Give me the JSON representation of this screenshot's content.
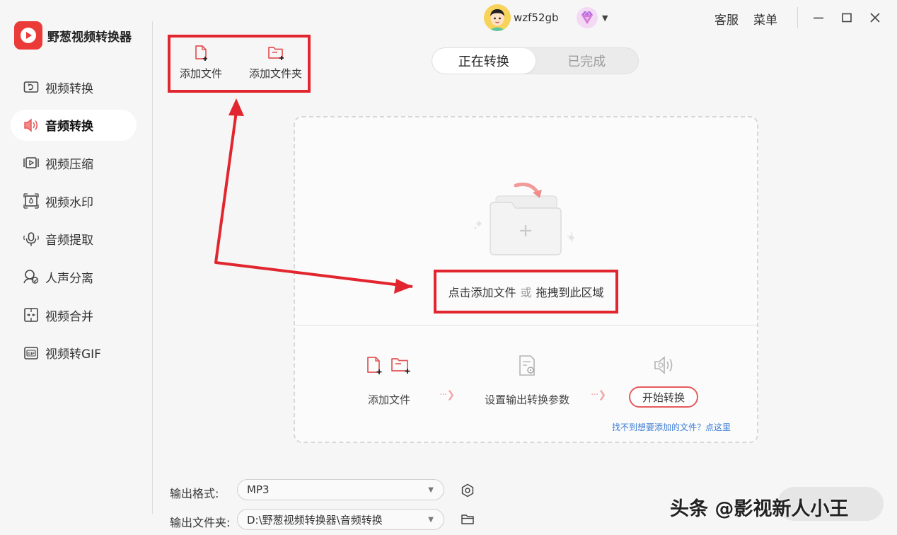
{
  "app": {
    "name": "野葱视频转换器",
    "accent": "#ea3b39"
  },
  "sidebar": {
    "items": [
      {
        "label": "视频转换",
        "icon": "video-convert-icon",
        "active": false
      },
      {
        "label": "音频转换",
        "icon": "audio-convert-icon",
        "active": true
      },
      {
        "label": "视频压缩",
        "icon": "video-compress-icon",
        "active": false
      },
      {
        "label": "视频水印",
        "icon": "video-watermark-icon",
        "active": false
      },
      {
        "label": "音频提取",
        "icon": "audio-extract-icon",
        "active": false
      },
      {
        "label": "人声分离",
        "icon": "vocal-separate-icon",
        "active": false
      },
      {
        "label": "视频合并",
        "icon": "video-merge-icon",
        "active": false
      },
      {
        "label": "视频转GIF",
        "icon": "video-gif-icon",
        "active": false
      }
    ]
  },
  "header": {
    "username": "wzf52gb",
    "service": "客服",
    "menu": "菜单"
  },
  "toolbar": {
    "add_file": "添加文件",
    "add_folder": "添加文件夹"
  },
  "tabs": {
    "converting": "正在转换",
    "done": "已完成"
  },
  "dropzone": {
    "click_add": "点击添加文件",
    "or": "或",
    "drag_here": "拖拽到此区域",
    "steps": {
      "add_file": "添加文件",
      "set_params": "设置输出转换参数",
      "start": "开始转换"
    },
    "help": "找不到想要添加的文件？点这里"
  },
  "footer": {
    "format_label": "输出格式:",
    "format_value": "MP3",
    "folder_label": "输出文件夹:",
    "folder_value": "D:\\野葱视频转换器\\音频转换"
  },
  "watermark": "头条 @影视新人小王",
  "colors": {
    "highlight_red": "#e2262f",
    "link_blue": "#3a7bd5"
  }
}
